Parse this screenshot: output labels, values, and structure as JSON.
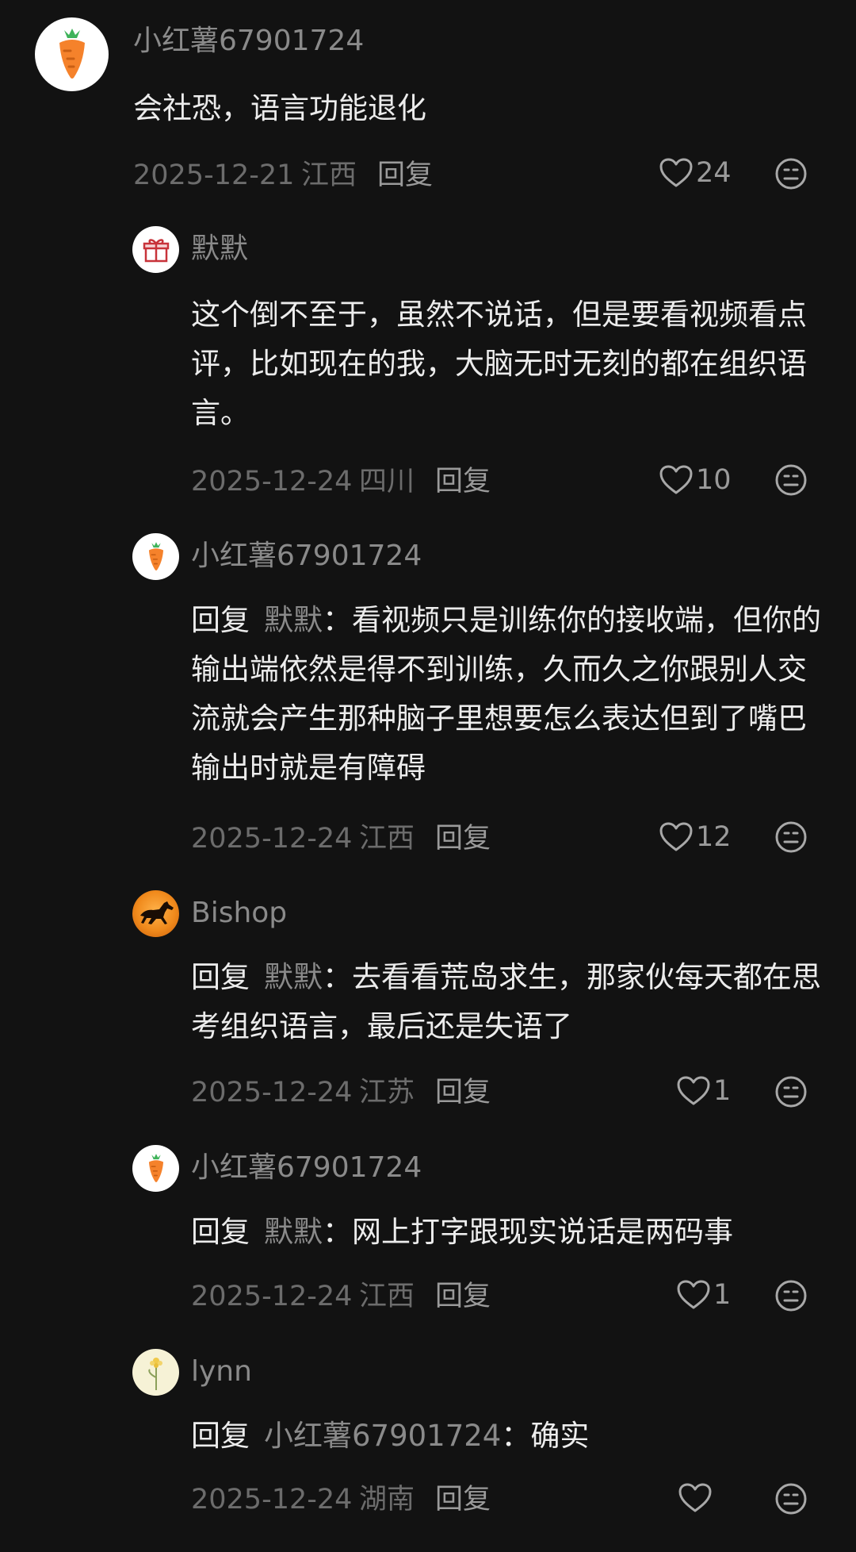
{
  "reply_word": "回复",
  "comments": [
    {
      "username": "小红薯67901724",
      "text": "会社恐，语言功能退化",
      "date": "2025-12-21",
      "location": "江西",
      "likes": "24"
    },
    {
      "username": "默默",
      "text": "这个倒不至于，虽然不说话，但是要看视频看点评，比如现在的我，大脑无时无刻的都在组织语言。",
      "date": "2025-12-24",
      "location": "四川",
      "likes": "10"
    },
    {
      "username": "小红薯67901724",
      "reply_to": "默默",
      "text": "看视频只是训练你的接收端，但你的输出端依然是得不到训练，久而久之你跟别人交流就会产生那种脑子里想要怎么表达但到了嘴巴输出时就是有障碍",
      "date": "2025-12-24",
      "location": "江西",
      "likes": "12"
    },
    {
      "username": "Bishop",
      "reply_to": "默默",
      "text": "去看看荒岛求生，那家伙每天都在思考组织语言，最后还是失语了",
      "date": "2025-12-24",
      "location": "江苏",
      "likes": "1"
    },
    {
      "username": "小红薯67901724",
      "reply_to": "默默",
      "text": "网上打字跟现实说话是两码事",
      "date": "2025-12-24",
      "location": "江西",
      "likes": "1"
    },
    {
      "username": "lynn",
      "reply_to": "小红薯67901724",
      "text": "确实",
      "date": "2025-12-24",
      "location": "湖南",
      "likes": ""
    }
  ],
  "colors": {
    "background": "#121212",
    "text_primary": "#ececec",
    "text_secondary": "#8a8a8a",
    "carrot_orange": "#f5822b",
    "carrot_leaf": "#3fb35a"
  }
}
